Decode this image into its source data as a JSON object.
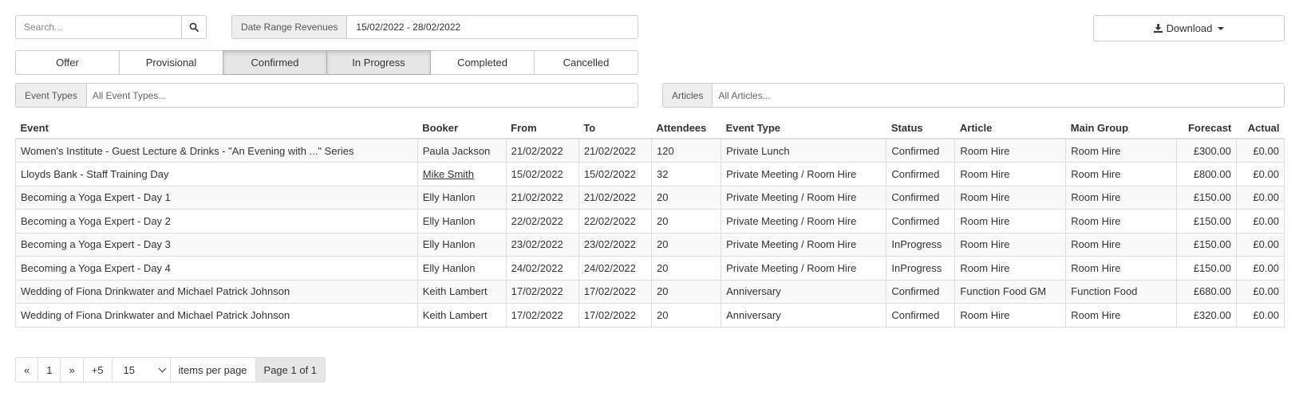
{
  "search": {
    "placeholder": "Search..."
  },
  "date_range": {
    "label": "Date Range Revenues",
    "value": "15/02/2022 - 28/02/2022"
  },
  "download": {
    "label": "Download"
  },
  "status_filters": [
    {
      "label": "Offer",
      "active": false
    },
    {
      "label": "Provisional",
      "active": false
    },
    {
      "label": "Confirmed",
      "active": true
    },
    {
      "label": "In Progress",
      "active": true
    },
    {
      "label": "Completed",
      "active": false
    },
    {
      "label": "Cancelled",
      "active": false
    }
  ],
  "event_types_filter": {
    "label": "Event Types",
    "placeholder": "All Event Types..."
  },
  "articles_filter": {
    "label": "Articles",
    "placeholder": "All Articles..."
  },
  "table": {
    "columns": [
      "Event",
      "Booker",
      "From",
      "To",
      "Attendees",
      "Event Type",
      "Status",
      "Article",
      "Main Group",
      "Forecast",
      "Actual"
    ],
    "rows": [
      [
        "Women's Institute - Guest Lecture & Drinks - \"An Evening with ...\" Series",
        "Paula Jackson",
        "21/02/2022",
        "21/02/2022",
        "120",
        "Private Lunch",
        "Confirmed",
        "Room Hire",
        "Room Hire",
        "£300.00",
        "£0.00"
      ],
      [
        "Lloyds Bank - Staff Training Day",
        "Mike Smith",
        "15/02/2022",
        "15/02/2022",
        "32",
        "Private Meeting / Room Hire",
        "Confirmed",
        "Room Hire",
        "Room Hire",
        "£800.00",
        "£0.00"
      ],
      [
        "Becoming a Yoga Expert - Day 1",
        "Elly Hanlon",
        "21/02/2022",
        "21/02/2022",
        "20",
        "Private Meeting / Room Hire",
        "Confirmed",
        "Room Hire",
        "Room Hire",
        "£150.00",
        "£0.00"
      ],
      [
        "Becoming a Yoga Expert - Day 2",
        "Elly Hanlon",
        "22/02/2022",
        "22/02/2022",
        "20",
        "Private Meeting / Room Hire",
        "Confirmed",
        "Room Hire",
        "Room Hire",
        "£150.00",
        "£0.00"
      ],
      [
        "Becoming a Yoga Expert - Day 3",
        "Elly Hanlon",
        "23/02/2022",
        "23/02/2022",
        "20",
        "Private Meeting / Room Hire",
        "InProgress",
        "Room Hire",
        "Room Hire",
        "£150.00",
        "£0.00"
      ],
      [
        "Becoming a Yoga Expert - Day 4",
        "Elly Hanlon",
        "24/02/2022",
        "24/02/2022",
        "20",
        "Private Meeting / Room Hire",
        "InProgress",
        "Room Hire",
        "Room Hire",
        "£150.00",
        "£0.00"
      ],
      [
        "Wedding of Fiona Drinkwater and Michael Patrick Johnson",
        "Keith Lambert",
        "17/02/2022",
        "17/02/2022",
        "20",
        "Anniversary",
        "Confirmed",
        "Function Food GM",
        "Function Food",
        "£680.00",
        "£0.00"
      ],
      [
        "Wedding of Fiona Drinkwater and Michael Patrick Johnson",
        "Keith Lambert",
        "17/02/2022",
        "17/02/2022",
        "20",
        "Anniversary",
        "Confirmed",
        "Room Hire",
        "Room Hire",
        "£320.00",
        "£0.00"
      ]
    ],
    "linked_bookers": [
      "Mike Smith"
    ]
  },
  "pagination": {
    "first": "«",
    "current": "1",
    "next": "»",
    "jump": "+5",
    "page_size": "15",
    "items_per_page_label": "items per page",
    "page_info": "Page 1 of 1"
  },
  "icons": {
    "search": "search-icon",
    "download": "download-icon",
    "caret": "caret-down-icon"
  }
}
